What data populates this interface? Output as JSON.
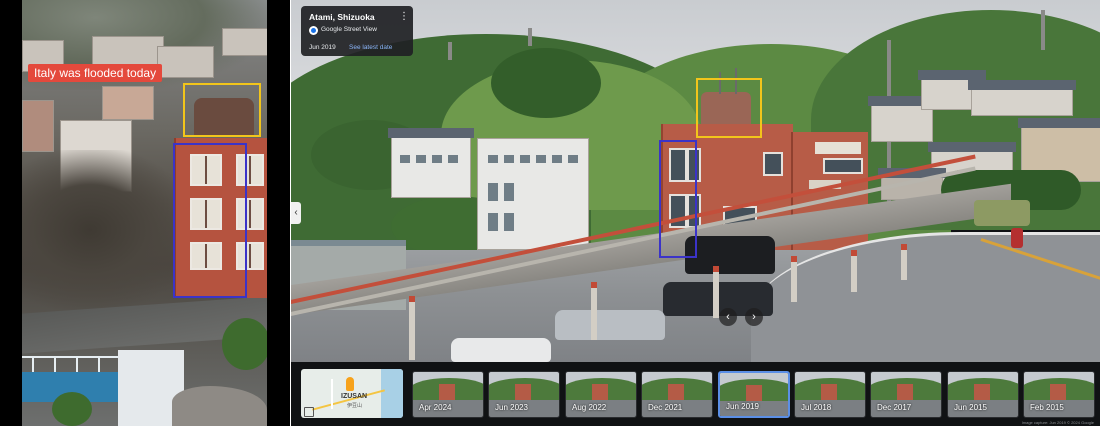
{
  "left_video": {
    "caption": "Italy was flooded today"
  },
  "street_view": {
    "location_title": "Atami, Shizuoka",
    "source_label": "Google Street View",
    "capture_date": "Jun 2019",
    "latest_date_link": "See latest date",
    "more_options_icon": "more-vert-icon",
    "nav_left_icon": "chevron-left-icon",
    "prev_icon": "chevron-left-icon",
    "next_icon": "chevron-right-icon"
  },
  "minimap": {
    "label": "IZUSAN",
    "sublabel": "伊豆山",
    "expand_icon": "expand-icon"
  },
  "timeline": {
    "selected_index": 4,
    "items": [
      {
        "label": "Apr 2024"
      },
      {
        "label": "Jun 2023"
      },
      {
        "label": "Aug 2022"
      },
      {
        "label": "Dec 2021"
      },
      {
        "label": "Jun 2019"
      },
      {
        "label": "Jul 2018"
      },
      {
        "label": "Dec 2017"
      },
      {
        "label": "Jun 2015"
      },
      {
        "label": "Feb 2015"
      }
    ]
  },
  "attribution": "Image capture: Jun 2019 © 2024 Google",
  "colors": {
    "highlight_yellow": "#f2c51b",
    "highlight_blue": "#3b33c8",
    "caption_red": "#e4493c",
    "link_blue": "#8ab4f8",
    "selected_thumb": "#5b8fe6"
  }
}
